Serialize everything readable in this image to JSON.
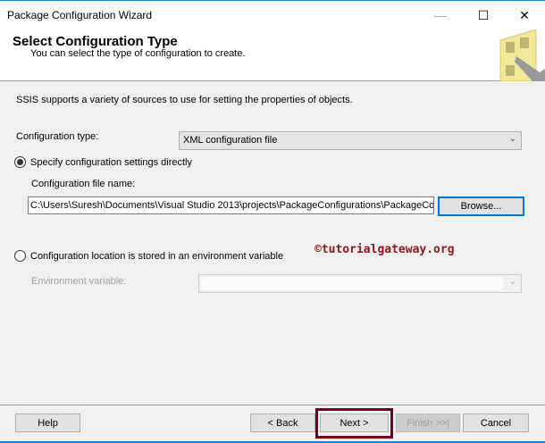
{
  "window": {
    "title": "Package Configuration Wizard",
    "controls": {
      "minimize": "—",
      "maximize": "☐",
      "close": "✕"
    }
  },
  "header": {
    "title": "Select Configuration Type",
    "subtitle": "You can select the type of configuration to create."
  },
  "intro": "SSIS supports a variety of sources to use for setting the properties of objects.",
  "config_type": {
    "label": "Configuration type:",
    "value": "XML configuration file"
  },
  "option_direct": {
    "label": "Specify configuration settings directly",
    "selected": true
  },
  "file_name": {
    "label": "Configuration file name:",
    "value": "C:\\Users\\Suresh\\Documents\\Visual Studio 2013\\projects\\PackageConfigurations\\PackageConfig",
    "browse": "Browse..."
  },
  "watermark": "©tutorialgateway.org",
  "option_env": {
    "label": "Configuration location is stored in an environment variable",
    "selected": false
  },
  "env_var": {
    "label": "Environment variable:",
    "value": ""
  },
  "footer": {
    "help": "Help",
    "back": "< Back",
    "next": "Next >",
    "finish": "Finish >>|",
    "cancel": "Cancel"
  },
  "colors": {
    "highlight": "#7a0019",
    "watermark": "#8b1a1a",
    "focus": "#0078d7"
  }
}
